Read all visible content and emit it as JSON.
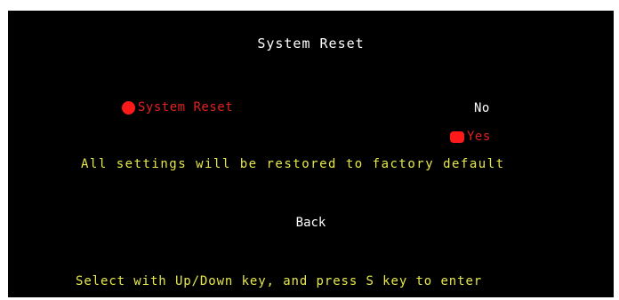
{
  "menu": {
    "title": "System Reset",
    "item_label": "System Reset",
    "options": {
      "no": "No",
      "yes": "Yes"
    },
    "selected_option": "yes",
    "notice": "All settings will be restored to factory default",
    "back_label": "Back",
    "hint": "Select with Up/Down key, and press S key to enter"
  },
  "colors": {
    "background": "#000000",
    "selected": "#e0201e",
    "normal": "#ffffff",
    "info": "#e6e84a"
  }
}
